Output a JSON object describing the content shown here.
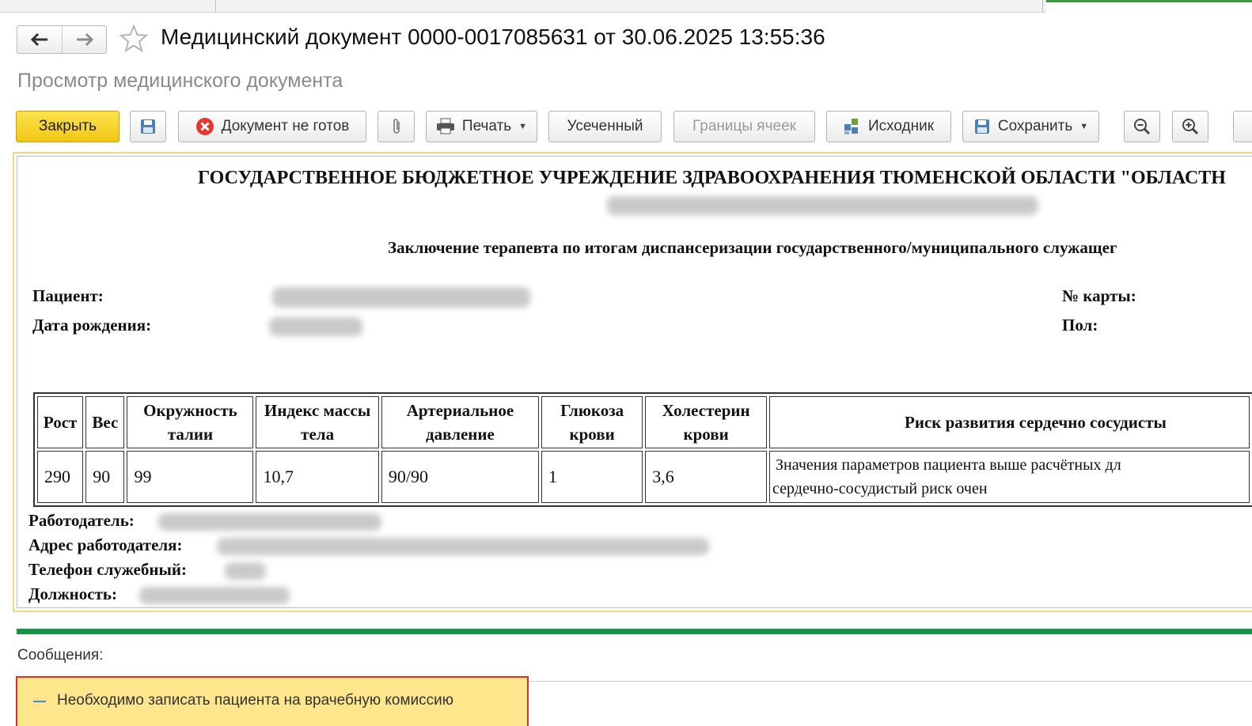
{
  "header": {
    "title": "Медицинский документ 0000-0017085631 от 30.06.2025 13:55:36",
    "subtitle": "Просмотр медицинского документа"
  },
  "toolbar": {
    "close": "Закрыть",
    "doc_status": "Документ не готов",
    "print": "Печать",
    "truncated": "Усеченный",
    "cell_borders": "Границы ячеек",
    "source": "Исходник",
    "save": "Сохранить"
  },
  "document": {
    "org_title": "ГОСУДАРСТВЕННОЕ БЮДЖЕТНОЕ УЧРЕЖДЕНИЕ ЗДРАВООХРАНЕНИЯ ТЮМЕНСКОЙ ОБЛАСТИ \"ОБЛАСТН",
    "conclusion_title": "Заключение терапевта по итогам диспансеризации государственного/муниципального служащег",
    "patient_label": "Пациент:",
    "dob_label": "Дата рождения:",
    "card_label": "№ карты:",
    "sex_label": "Пол:",
    "table": {
      "headers": [
        "Рост",
        "Вес",
        "Окружность талии",
        "Индекс массы тела",
        "Артериальное давление",
        "Глюкоза крови",
        "Холестерин крови",
        "Риск развития сердечно сосудисты"
      ],
      "row": [
        "290",
        "90",
        "99",
        "10,7",
        "90/90",
        "1",
        "3,6"
      ],
      "risk_line1": "Значения параметров пациента выше расчётных дл",
      "risk_line2": "сердечно-сосудистый риск очен"
    },
    "employer_label": "Работодатель:",
    "employer_address_label": "Адрес работодателя:",
    "work_phone_label": "Телефон служебный:",
    "position_label": "Должность:"
  },
  "messages": {
    "title": "Сообщения:",
    "items": [
      "Необходимо записать пациента на врачебную комиссию"
    ]
  },
  "colors": {
    "primary_button": "#f5d026",
    "separator": "#149443",
    "message_bg": "#fde68c",
    "message_border": "#e22b2b",
    "error_icon": "#e03a2f"
  }
}
